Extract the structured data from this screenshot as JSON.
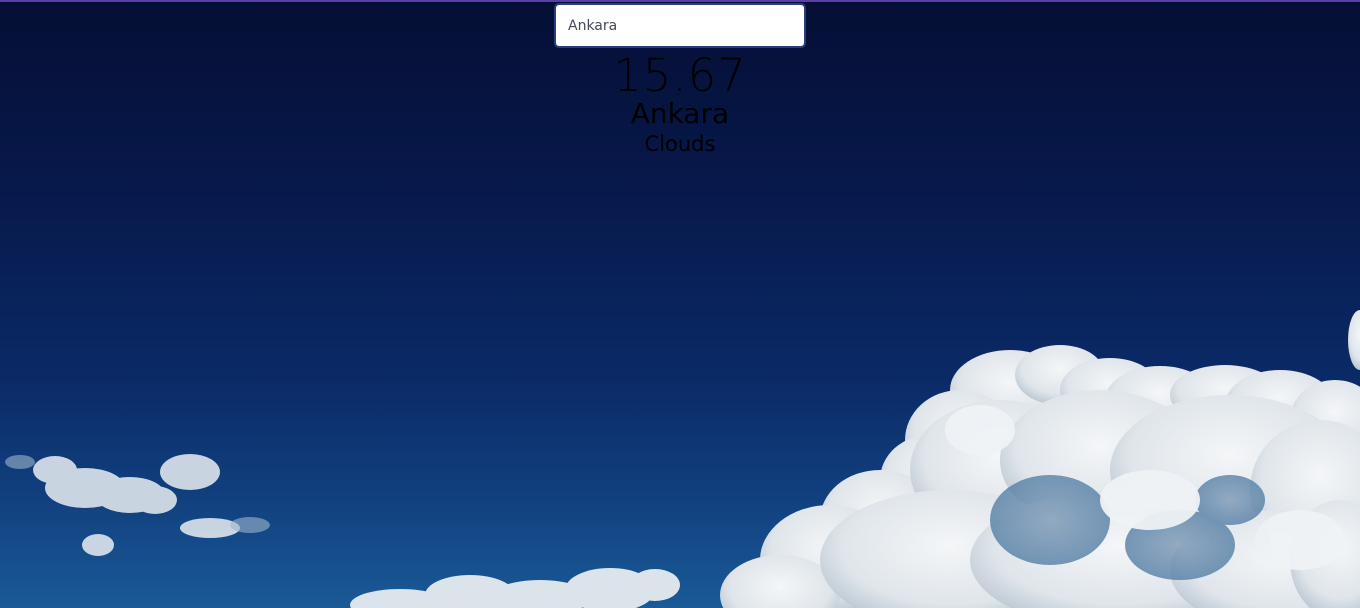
{
  "search": {
    "value": "Ankara",
    "placeholder": ""
  },
  "weather": {
    "temperature": "15.67",
    "city": "Ankara",
    "condition": "Clouds"
  }
}
